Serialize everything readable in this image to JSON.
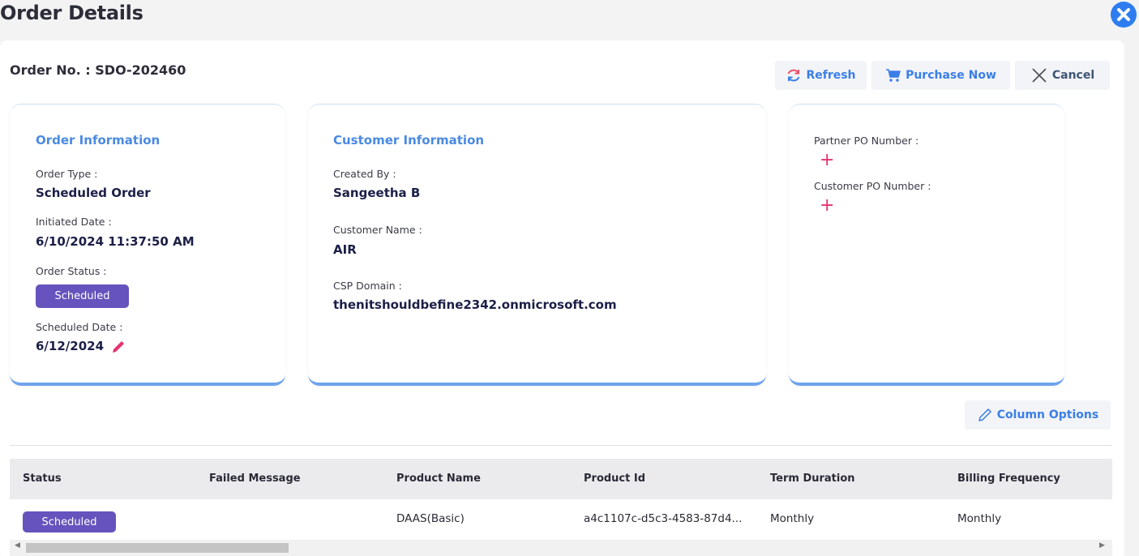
{
  "header": {
    "title": "Order Details"
  },
  "order": {
    "number_label": "Order No. : SDO-202460"
  },
  "toolbar": {
    "refresh_label": "Refresh",
    "purchase_label": "Purchase Now",
    "cancel_label": "Cancel"
  },
  "order_info": {
    "title": "Order Information",
    "order_type_label": "Order Type :",
    "order_type_value": "Scheduled Order",
    "initiated_date_label": "Initiated Date :",
    "initiated_date_value": "6/10/2024 11:37:50 AM",
    "order_status_label": "Order Status :",
    "order_status_value": "Scheduled",
    "scheduled_date_label": "Scheduled Date :",
    "scheduled_date_value": "6/12/2024"
  },
  "customer_info": {
    "title": "Customer Information",
    "created_by_label": "Created By :",
    "created_by_value": "Sangeetha B",
    "customer_name_label": "Customer Name :",
    "customer_name_value": "AIR",
    "csp_domain_label": "CSP Domain :",
    "csp_domain_value": "thenitshouldbefine2342.onmicrosoft.com"
  },
  "po_info": {
    "partner_po_label": "Partner PO Number :",
    "customer_po_label": "Customer PO Number :",
    "add_symbol": "+"
  },
  "column_options_label": "Column Options",
  "table": {
    "headers": [
      "Status",
      "Failed Message",
      "Product Name",
      "Product Id",
      "Term Duration",
      "Billing Frequency"
    ],
    "rows": [
      {
        "status": "Scheduled",
        "failed_message": "",
        "product_name": "DAAS(Basic)",
        "product_id": "a4c1107c-d5c3-4583-87d4...",
        "term_duration": "Monthly",
        "billing_frequency": "Monthly"
      }
    ]
  },
  "icons": {
    "close": "close-icon",
    "refresh": "refresh-icon",
    "cart": "cart-icon",
    "cancel": "x-icon",
    "edit": "pencil-icon",
    "column_options": "pencil-outline-icon"
  },
  "colors": {
    "accent_blue": "#3a7ee8",
    "badge_purple": "#6653bd",
    "plus_pink": "#e5336d",
    "close_blue": "#2e7df0"
  }
}
